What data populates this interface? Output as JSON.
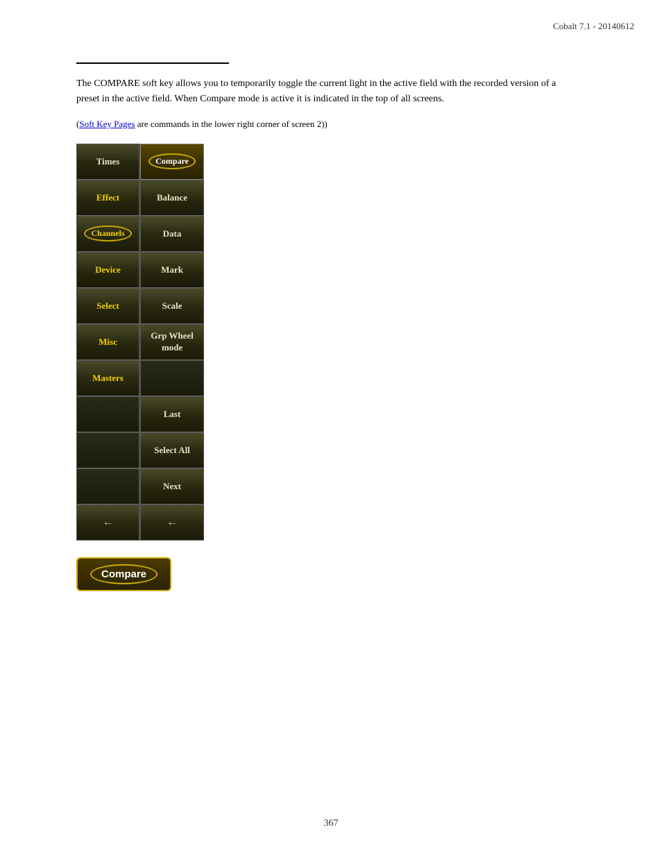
{
  "header": {
    "version": "Cobalt 7.1 - 20140612"
  },
  "description": {
    "text": "The COMPARE soft key allows you to temporarily toggle the current light in the active field with the recorded version of a preset in the active field. When Compare mode is active it is indicated in the top of all screens.",
    "note_prefix": "(",
    "soft_key_link": "Soft Key Pages",
    "note_suffix": " are commands in the lower right corner of screen 2)"
  },
  "left_column": [
    {
      "label": "Times",
      "style": "normal"
    },
    {
      "label": "Effect",
      "style": "yellow"
    },
    {
      "label": "Channels",
      "style": "channels-oval"
    },
    {
      "label": "Device",
      "style": "yellow"
    },
    {
      "label": "Select",
      "style": "yellow"
    },
    {
      "label": "Misc",
      "style": "yellow"
    },
    {
      "label": "Masters",
      "style": "yellow"
    },
    {
      "label": "",
      "style": "empty"
    },
    {
      "label": "",
      "style": "empty"
    },
    {
      "label": "",
      "style": "empty"
    },
    {
      "label": "←",
      "style": "back"
    }
  ],
  "right_column": [
    {
      "label": "Compare",
      "style": "compare-oval"
    },
    {
      "label": "Balance",
      "style": "normal"
    },
    {
      "label": "Data",
      "style": "normal"
    },
    {
      "label": "Mark",
      "style": "normal"
    },
    {
      "label": "Scale",
      "style": "normal"
    },
    {
      "label": "Grp Wheel\nmode",
      "style": "multiline"
    },
    {
      "label": "",
      "style": "empty"
    },
    {
      "label": "Last",
      "style": "normal"
    },
    {
      "label": "Select All",
      "style": "normal"
    },
    {
      "label": "Next",
      "style": "normal"
    },
    {
      "label": "←",
      "style": "back"
    }
  ],
  "compare_button": {
    "label": "Compare"
  },
  "page_number": "367"
}
